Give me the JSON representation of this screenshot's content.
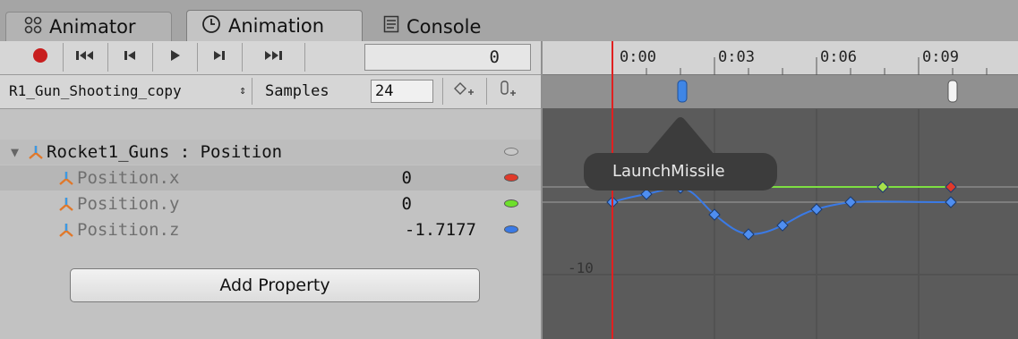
{
  "tabs": [
    {
      "label": "Animator",
      "icon": "animator-icon"
    },
    {
      "label": "Animation",
      "icon": "clock-icon"
    },
    {
      "label": "Console",
      "icon": "console-icon"
    }
  ],
  "toolbar": {
    "record": "record-icon",
    "first_key": "first-keyframe-icon",
    "prev_key": "previous-keyframe-icon",
    "play": "play-icon",
    "next_key": "next-keyframe-icon",
    "last_key": "last-keyframe-icon",
    "frame_value": "0"
  },
  "clip_bar": {
    "clip_name": "R1_Gun_Shooting_copy",
    "samples_label": "Samples",
    "samples_value": "24"
  },
  "properties": {
    "group_label": "Rocket1_Guns : Position",
    "items": [
      {
        "label": "Position.x",
        "value": "0",
        "color": "#e03a2a"
      },
      {
        "label": "Position.y",
        "value": "0",
        "color": "#6ee02b"
      },
      {
        "label": "Position.z",
        "value": "-1.7177",
        "color": "#3a7ae6"
      }
    ],
    "add_button": "Add Property"
  },
  "timeline": {
    "ticks": [
      "0:00",
      "0:03",
      "0:06",
      "0:09"
    ],
    "tooltip": "LaunchMissile",
    "ytick": "-10"
  },
  "colors": {
    "x_curve": "#e03a2a",
    "y_curve": "#7ee042",
    "z_curve": "#3a7ae6",
    "playhead": "#e02020"
  }
}
